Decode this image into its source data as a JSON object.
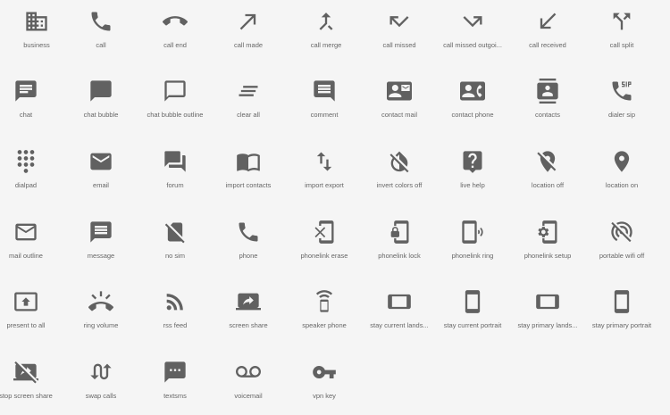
{
  "icon_color": "#616161",
  "background": "#f5f5f5",
  "icons": [
    {
      "name": "business-icon",
      "label": "business"
    },
    {
      "name": "call-icon",
      "label": "call"
    },
    {
      "name": "call-end-icon",
      "label": "call end"
    },
    {
      "name": "call-made-icon",
      "label": "call made"
    },
    {
      "name": "call-merge-icon",
      "label": "call merge"
    },
    {
      "name": "call-missed-icon",
      "label": "call missed"
    },
    {
      "name": "call-missed-outgoing-icon",
      "label": "call missed outgoi..."
    },
    {
      "name": "call-received-icon",
      "label": "call received"
    },
    {
      "name": "call-split-icon",
      "label": "call split"
    },
    {
      "name": "chat-icon",
      "label": "chat"
    },
    {
      "name": "chat-bubble-icon",
      "label": "chat bubble"
    },
    {
      "name": "chat-bubble-outline-icon",
      "label": "chat bubble outline"
    },
    {
      "name": "clear-all-icon",
      "label": "clear all"
    },
    {
      "name": "comment-icon",
      "label": "comment"
    },
    {
      "name": "contact-mail-icon",
      "label": "contact mail"
    },
    {
      "name": "contact-phone-icon",
      "label": "contact phone"
    },
    {
      "name": "contacts-icon",
      "label": "contacts"
    },
    {
      "name": "dialer-sip-icon",
      "label": "dialer sip"
    },
    {
      "name": "dialpad-icon",
      "label": "dialpad"
    },
    {
      "name": "email-icon",
      "label": "email"
    },
    {
      "name": "forum-icon",
      "label": "forum"
    },
    {
      "name": "import-contacts-icon",
      "label": "import contacts"
    },
    {
      "name": "import-export-icon",
      "label": "import export"
    },
    {
      "name": "invert-colors-off-icon",
      "label": "invert colors off"
    },
    {
      "name": "live-help-icon",
      "label": "live help"
    },
    {
      "name": "location-off-icon",
      "label": "location off"
    },
    {
      "name": "location-on-icon",
      "label": "location on"
    },
    {
      "name": "mail-outline-icon",
      "label": "mail outline"
    },
    {
      "name": "message-icon",
      "label": "message"
    },
    {
      "name": "no-sim-icon",
      "label": "no sim"
    },
    {
      "name": "phone-icon",
      "label": "phone"
    },
    {
      "name": "phonelink-erase-icon",
      "label": "phonelink erase"
    },
    {
      "name": "phonelink-lock-icon",
      "label": "phonelink lock"
    },
    {
      "name": "phonelink-ring-icon",
      "label": "phonelink ring"
    },
    {
      "name": "phonelink-setup-icon",
      "label": "phonelink setup"
    },
    {
      "name": "portable-wifi-off-icon",
      "label": "portable wifi off"
    },
    {
      "name": "present-to-all-icon",
      "label": "present to all"
    },
    {
      "name": "ring-volume-icon",
      "label": "ring volume"
    },
    {
      "name": "rss-feed-icon",
      "label": "rss feed"
    },
    {
      "name": "screen-share-icon",
      "label": "screen share"
    },
    {
      "name": "speaker-phone-icon",
      "label": "speaker phone"
    },
    {
      "name": "stay-current-landscape-icon",
      "label": "stay current lands..."
    },
    {
      "name": "stay-current-portrait-icon",
      "label": "stay current portrait"
    },
    {
      "name": "stay-primary-landscape-icon",
      "label": "stay primary lands..."
    },
    {
      "name": "stay-primary-portrait-icon",
      "label": "stay primary portrait"
    },
    {
      "name": "stop-screen-share-icon",
      "label": "stop screen share"
    },
    {
      "name": "swap-calls-icon",
      "label": "swap calls"
    },
    {
      "name": "textsms-icon",
      "label": "textsms"
    },
    {
      "name": "voicemail-icon",
      "label": "voicemail"
    },
    {
      "name": "vpn-key-icon",
      "label": "vpn key"
    }
  ]
}
